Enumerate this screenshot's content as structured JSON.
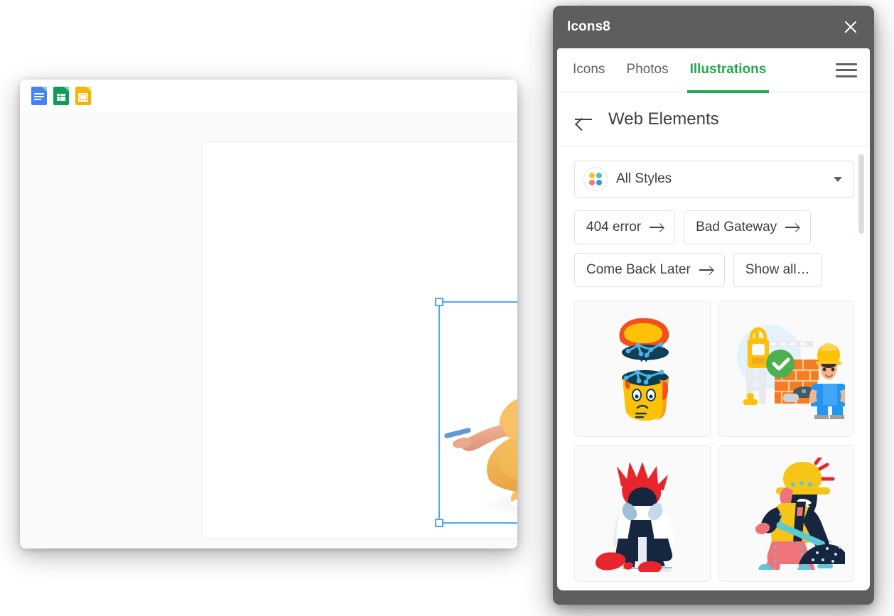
{
  "document_window": {
    "toolbar": {
      "apps": [
        {
          "name": "google-docs",
          "label": "Docs"
        },
        {
          "name": "google-sheets",
          "label": "Sheets"
        },
        {
          "name": "google-slides",
          "label": "Slides"
        }
      ]
    },
    "canvas": {
      "selected_object": "3d-character-illustration",
      "selection": {
        "handles": 4,
        "color": "#4ba9f5"
      },
      "placeholder_lines": 2
    }
  },
  "panel": {
    "title": "Icons8",
    "close_label": "×",
    "header_color": "#5e5e5e",
    "accent_color": "#22a94e",
    "tabs": [
      {
        "label": "Icons",
        "active": false
      },
      {
        "label": "Photos",
        "active": false
      },
      {
        "label": "Illustrations",
        "active": true
      }
    ],
    "menu_label": "Menu",
    "subheader": {
      "back_label": "Back",
      "title": "Web Elements"
    },
    "style_filter": {
      "label": "All Styles",
      "dot_colors": [
        "#fbc02d",
        "#4fc3c0",
        "#ef7b73",
        "#3d8ef0"
      ]
    },
    "chips": [
      {
        "label": "404 error",
        "arrow": true
      },
      {
        "label": "Bad Gateway",
        "arrow": true
      },
      {
        "label": "Come Back Later",
        "arrow": true
      },
      {
        "label": "Show all…",
        "arrow": false
      }
    ],
    "results": [
      {
        "name": "broken-cup-illustration",
        "alt": "Orange cup character breaking apart"
      },
      {
        "name": "under-construction-worker",
        "alt": "Builder with bricks, crane and check mark"
      },
      {
        "name": "frustrated-person-illustration",
        "alt": "Person with red hair sitting head in hands"
      },
      {
        "name": "digging-worker-illustration",
        "alt": "Worker in yellow helmet digging a pile"
      }
    ],
    "scrollbar": {
      "visible": true
    }
  }
}
